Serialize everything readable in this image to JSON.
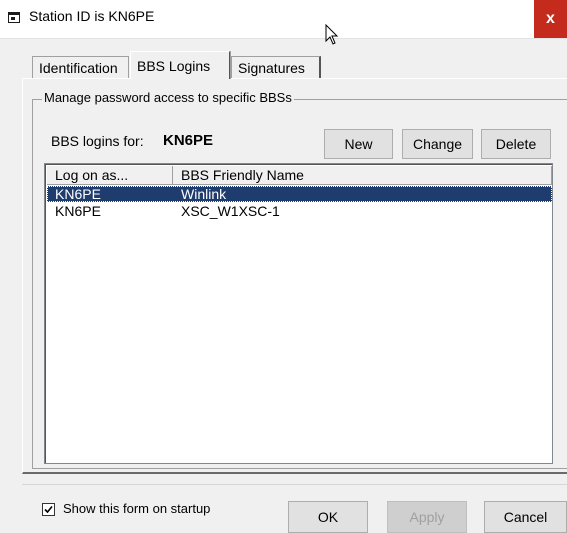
{
  "window": {
    "title": "Station ID is KN6PE",
    "close_label": "x"
  },
  "tabs": [
    {
      "label": "Identification",
      "active": false
    },
    {
      "label": "BBS Logins",
      "active": true
    },
    {
      "label": "Signatures",
      "active": false
    }
  ],
  "group": {
    "label": "Manage password access to specific BBSs"
  },
  "logins": {
    "label": "BBS logins for:",
    "callsign": "KN6PE",
    "new_label": "New",
    "change_label": "Change",
    "delete_label": "Delete"
  },
  "list": {
    "columns": [
      "Log on as...",
      "BBS Friendly Name"
    ],
    "rows": [
      {
        "log_on_as": "KN6PE",
        "name": "Winlink",
        "selected": true
      },
      {
        "log_on_as": "KN6PE",
        "name": "XSC_W1XSC-1",
        "selected": false
      }
    ]
  },
  "footer": {
    "checkbox_label": "Show this form on startup",
    "checkbox_checked": true,
    "ok_label": "OK",
    "apply_label": "Apply",
    "apply_enabled": false,
    "cancel_label": "Cancel"
  },
  "colors": {
    "close_red": "#c42b1c",
    "selection_blue": "#1e3c6e"
  }
}
